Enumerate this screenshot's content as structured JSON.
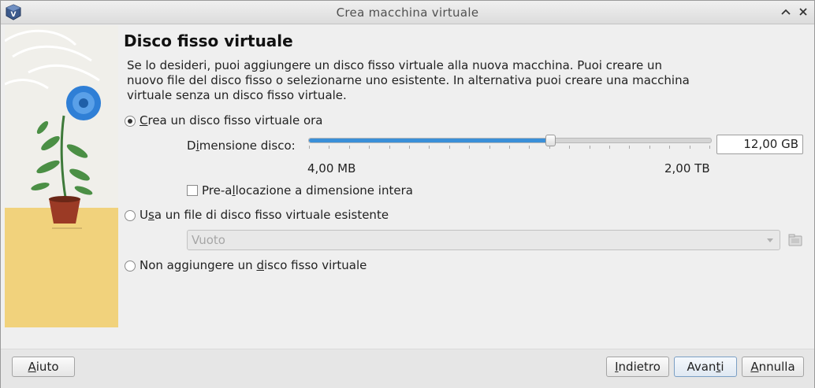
{
  "window": {
    "title": "Crea macchina virtuale",
    "minimize_label": "^",
    "close_label": "✕"
  },
  "page": {
    "heading": "Disco fisso virtuale",
    "description": "Se lo desideri, puoi aggiungere un disco fisso virtuale alla nuova macchina. Puoi creare un nuovo file del disco fisso o selezionarne uno esistente. In alternativa puoi creare una macchina virtuale senza un disco fisso virtuale."
  },
  "options": {
    "create_now": {
      "first": "C",
      "rest": "rea un disco fisso virtuale ora",
      "selected": true
    },
    "size": {
      "label_a": "D",
      "label_b": "i",
      "label_c": "mensione disco:",
      "min_label": "4,00 MB",
      "max_label": "2,00 TB",
      "value": "12,00 GB",
      "slider_fraction": 0.6
    },
    "prealloc": {
      "a": "Pre-a",
      "b": "l",
      "c": "locazione a dimensione intera",
      "checked": false
    },
    "use_existing": {
      "a": "U",
      "b": "s",
      "c": "a un file di disco fisso virtuale esistente",
      "selected": false
    },
    "existing_combo": {
      "value": "Vuoto"
    },
    "no_disk": {
      "a": "Non aggiungere un ",
      "b": "d",
      "c": "isco fisso virtuale",
      "selected": false
    }
  },
  "buttons": {
    "help": {
      "a": "A",
      "b": "iuto"
    },
    "back": {
      "a": "I",
      "b": "ndietro"
    },
    "next": {
      "a": "Avan",
      "b": "t",
      "c": "i"
    },
    "cancel": {
      "a": "A",
      "b": "n",
      "c": "nulla"
    }
  },
  "colors": {
    "accent": "#3a8fd8",
    "flower": "#2f7fd6",
    "ground": "#f1d27c"
  }
}
